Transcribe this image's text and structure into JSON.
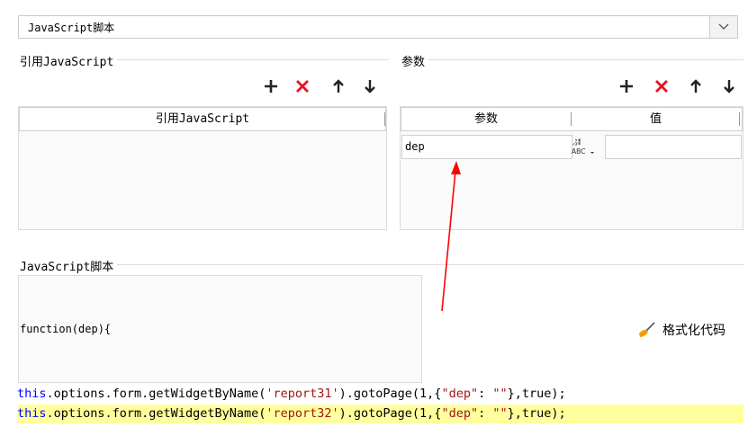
{
  "script_type_select": {
    "value": "JavaScript脚本"
  },
  "ref_group": {
    "title": "引用JavaScript",
    "column_header": "引用JavaScript"
  },
  "param_group": {
    "title": "参数",
    "columns": [
      "参数",
      "值"
    ],
    "rows": [
      {
        "name": "dep",
        "value": ""
      }
    ]
  },
  "toolbar_icons": [
    "add-icon",
    "delete-icon",
    "move-up-icon",
    "move-down-icon"
  ],
  "script_group": {
    "title": "JavaScript脚本",
    "function_signature": "function(dep){",
    "format_button_label": "格式化代码"
  },
  "code": {
    "lines": [
      {
        "keyword": "this",
        "pre": ".options.form.getWidgetByName(",
        "str1": "'report31'",
        "mid": ").gotoPage(1,{",
        "str2": "\"dep\"",
        "colon": ": ",
        "str3": "\"\"",
        "post": "},true);"
      },
      {
        "keyword": "this",
        "pre": ".options.form.getWidgetByName(",
        "str1": "'report32'",
        "mid": ").gotoPage(1,{",
        "str2": "\"dep\"",
        "colon": ": ",
        "str3": "\"\"",
        "post": "},true);"
      }
    ]
  },
  "colors": {
    "delete_red": "#e81123",
    "keyword_blue": "#0000ff",
    "string_red": "#a31515",
    "highlight_yellow": "#ffff9e",
    "annotation_arrow": "#ff0000"
  }
}
